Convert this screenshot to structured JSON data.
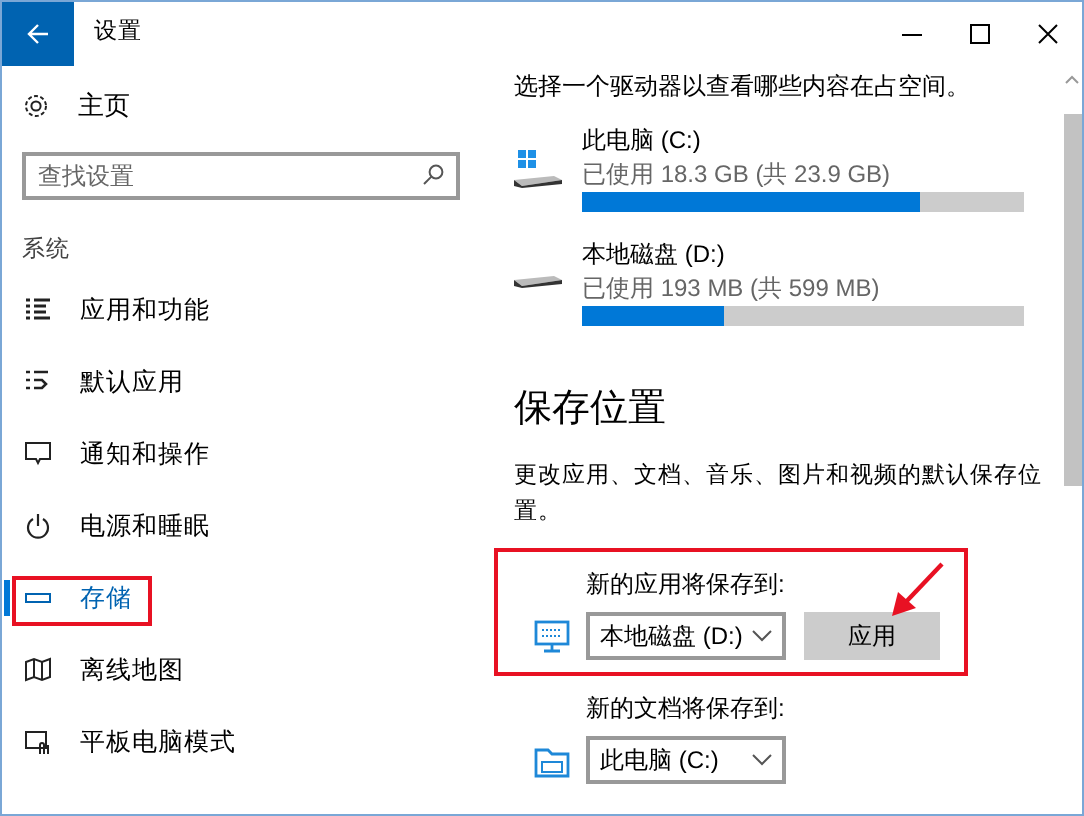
{
  "window": {
    "title": "设置"
  },
  "sidebar": {
    "home": "主页",
    "search": {
      "placeholder": "查找设置"
    },
    "section": "系统",
    "items": [
      {
        "label": "应用和功能",
        "kind": "list",
        "selected": false,
        "highlighted": false
      },
      {
        "label": "默认应用",
        "kind": "defaults",
        "selected": false,
        "highlighted": false
      },
      {
        "label": "通知和操作",
        "kind": "notify",
        "selected": false,
        "highlighted": false
      },
      {
        "label": "电源和睡眠",
        "kind": "power",
        "selected": false,
        "highlighted": false
      },
      {
        "label": "存储",
        "kind": "storage",
        "selected": true,
        "highlighted": true
      },
      {
        "label": "离线地图",
        "kind": "map",
        "selected": false,
        "highlighted": false
      },
      {
        "label": "平板电脑模式",
        "kind": "tablet",
        "selected": false,
        "highlighted": false
      }
    ]
  },
  "content": {
    "intro": "选择一个驱动器以查看哪些内容在占空间。",
    "drives": [
      {
        "kind": "system",
        "name": "此电脑 (C:)",
        "usage": "已使用 18.3 GB (共 23.9 GB)",
        "level": 0.766
      },
      {
        "kind": "disk",
        "name": "本地磁盘 (D:)",
        "usage": "已使用 193 MB (共 599 MB)",
        "level": 0.322
      }
    ],
    "section_title": "保存位置",
    "description": "更改应用、文档、音乐、图片和视频的默认保存位置。",
    "save_locations": [
      {
        "kind": "apps",
        "label": "新的应用将保存到:",
        "value": "本地磁盘 (D:)",
        "button": "应用",
        "highlighted": true,
        "arrow": true
      },
      {
        "kind": "documents",
        "label": "新的文档将保存到:",
        "value": "此电脑 (C:)",
        "highlighted": false,
        "arrow": false
      }
    ]
  }
}
